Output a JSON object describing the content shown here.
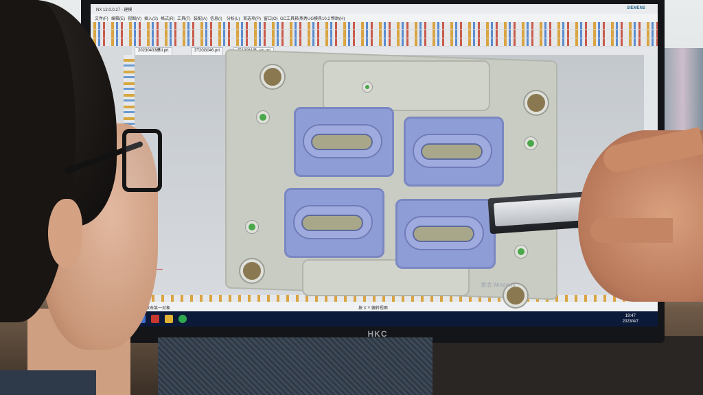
{
  "screen": {
    "app_title": "NX 12.0.0.27 - 建模",
    "vendor_logo": "SIEMENS",
    "menu_items": [
      "文件(F)",
      "编辑(E)",
      "视图(V)",
      "插入(S)",
      "格式(R)",
      "工具(T)",
      "装配(A)",
      "信息(I)",
      "分析(L)",
      "首选项(P)",
      "窗口(O)",
      "GC工具箱",
      "燕秀UG模具10.2",
      "帮助(H)"
    ],
    "tabs": [
      "20230403模II.prt",
      "3T20G046.prt",
      "JT19061IB_stp.prt"
    ],
    "active_tab": 2,
    "status_text": "选择对象并使用 MB3，或者双击某一对象",
    "view_name": "按 X Y 偏转视图",
    "activation_watermark": "激活 Windows",
    "clock_time": "19:47",
    "clock_date": "2023/4/7"
  },
  "monitor": {
    "brand": "HKC"
  },
  "colors": {
    "cavity": "#8f9dd6",
    "plate": "#c9ccc3",
    "pin": "#4aa84a",
    "taskbar": "#0c1a3a"
  }
}
